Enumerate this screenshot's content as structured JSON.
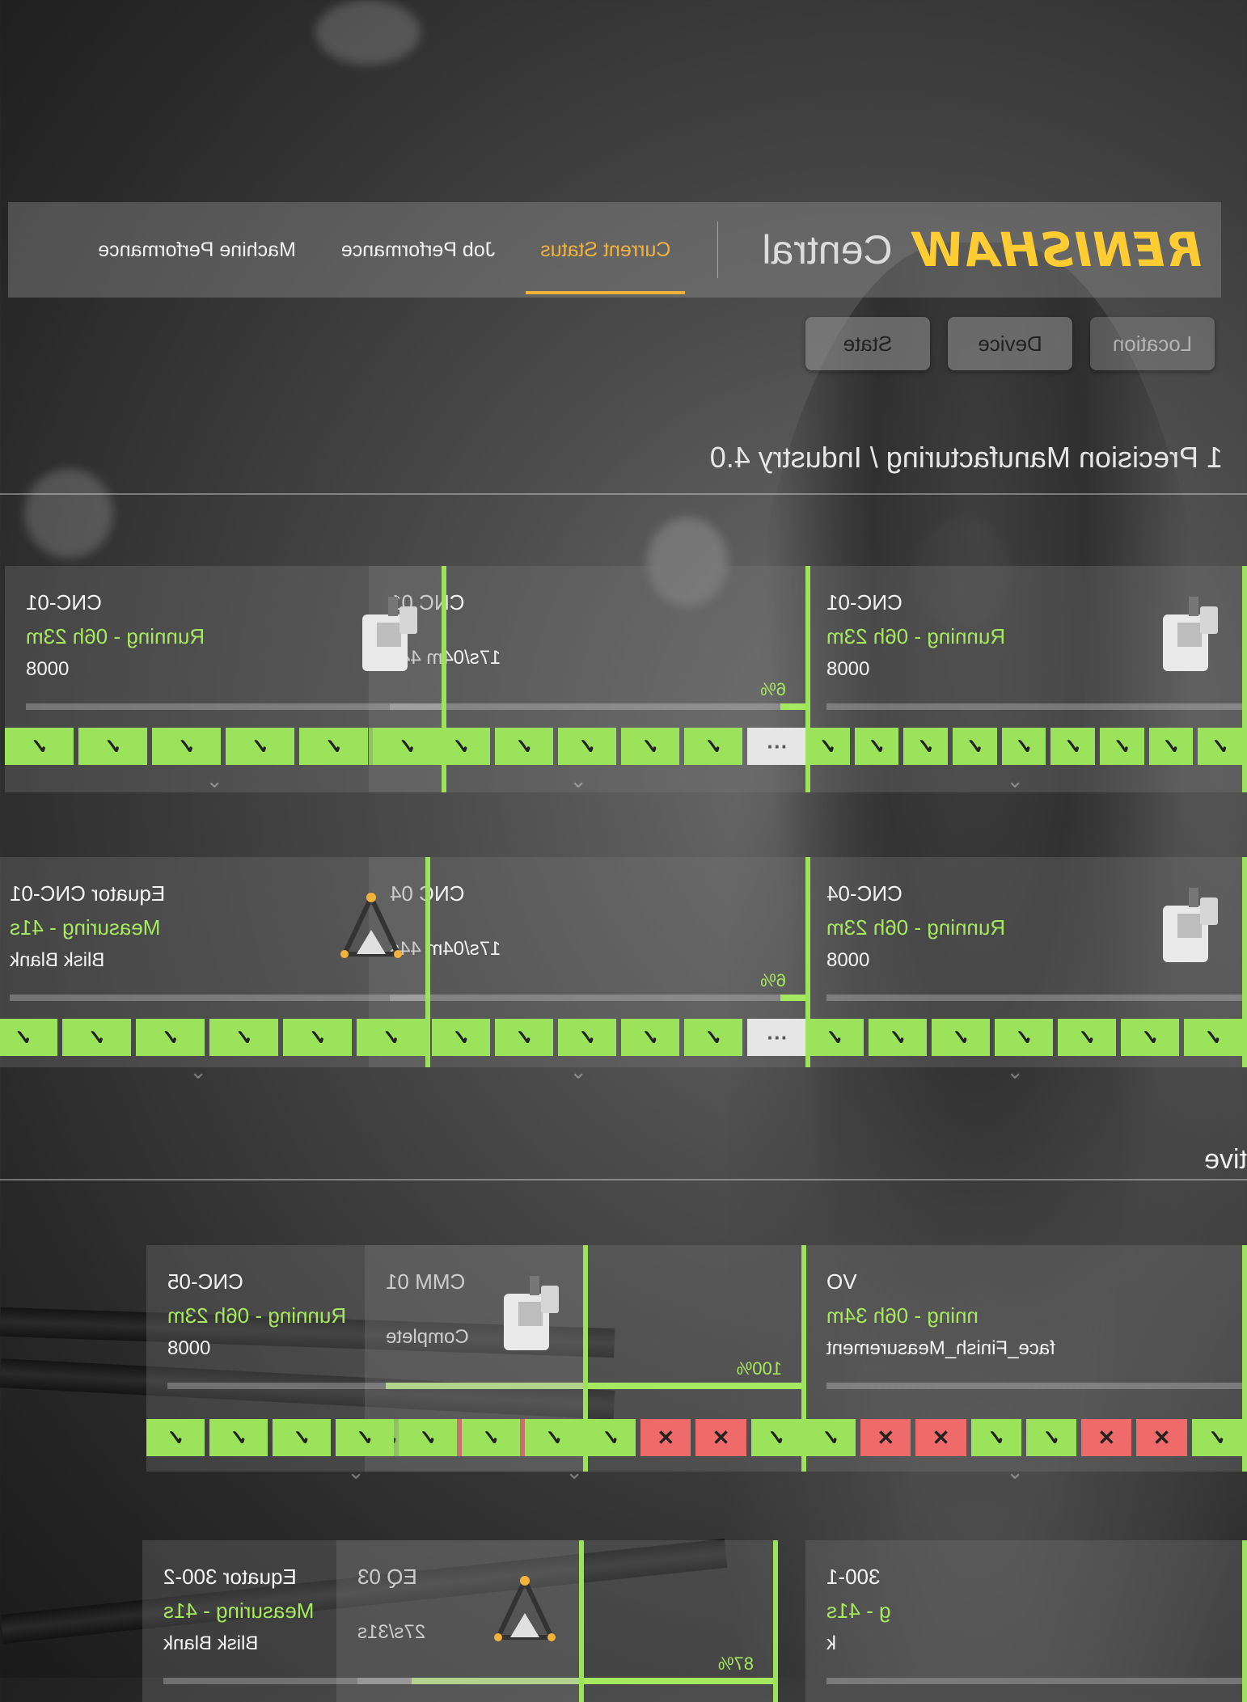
{
  "brand": {
    "logo_text": "RENISHAW",
    "app_name": "Central"
  },
  "nav": {
    "tabs": [
      {
        "label": "Current Status",
        "active": true
      },
      {
        "label": "Job Performance",
        "active": false
      },
      {
        "label": "Machine Performance",
        "active": false
      }
    ]
  },
  "filters": [
    "Location",
    "Device",
    "State"
  ],
  "breadcrumb": "1 Precision Manufacturing / Industry 4.0",
  "sections": {
    "active_label_fragment": "tive"
  },
  "colors": {
    "accent": "#f3b23a",
    "ok": "#9be35a",
    "fail": "#ef6b6b",
    "brand": "#ffcc33"
  },
  "cards": [
    {
      "id": "c1",
      "name": "CNC-01",
      "state": "Running - 06h 23m",
      "detail": "0008",
      "icon": "cnc-machine-icon",
      "steps": [
        "ok",
        "ok",
        "ok",
        "ok",
        "ok",
        "ok",
        "ok",
        "ok",
        "ok"
      ]
    },
    {
      "id": "c2",
      "name": "CNC 01",
      "state": "",
      "detail": "17s/04m 44s",
      "progress": "6%",
      "progress_value": 0.06,
      "icon": "",
      "steps": [
        "more",
        "ok",
        "ok",
        "ok",
        "ok",
        "ok",
        "ok"
      ]
    },
    {
      "id": "c3",
      "name": "CNC-01",
      "state": "Running - 06h 23m",
      "detail": "0008",
      "icon": "cnc-machine-icon",
      "steps": [
        "ok",
        "ok",
        "ok",
        "ok",
        "ok",
        "ok"
      ]
    },
    {
      "id": "c4",
      "name": "CNC-04",
      "state": "Running - 06h 23m",
      "detail": "0008",
      "icon": "cnc-machine-icon",
      "steps": [
        "ok",
        "ok",
        "ok",
        "ok",
        "ok",
        "ok",
        "ok"
      ]
    },
    {
      "id": "c5",
      "name": "CNC 04",
      "state": "",
      "detail": "17s/04m 44s",
      "progress": "6%",
      "progress_value": 0.06,
      "icon": "",
      "steps": [
        "more",
        "ok",
        "ok",
        "ok",
        "ok",
        "ok",
        "ok"
      ]
    },
    {
      "id": "c6",
      "name": "Equator CNC-01",
      "state": "Measuring - 41s",
      "detail": "Blisk Blank",
      "icon": "equator-gauge-icon",
      "steps": [
        "ok",
        "ok",
        "ok",
        "ok",
        "ok",
        "ok"
      ]
    },
    {
      "id": "c7",
      "name": "VO",
      "state": "nning - 06h 34m",
      "detail": "face_Finish_Measurement",
      "icon": "",
      "steps": [
        "ok",
        "fail",
        "fail",
        "ok",
        "ok",
        "fail",
        "fail",
        "ok"
      ]
    },
    {
      "id": "c8",
      "name": "CMM 01",
      "state": "",
      "detail": "Complete",
      "progress": "100%",
      "progress_value": 1.0,
      "icon": "",
      "steps": [
        "ok",
        "fail",
        "fail",
        "ok",
        "ok",
        "fail",
        "fail",
        "ok"
      ]
    },
    {
      "id": "c9",
      "name": "CNC-05",
      "state": "Running - 06h 23m",
      "detail": "0008",
      "icon": "cnc-machine-icon",
      "steps": [
        "ok",
        "ok",
        "ok",
        "ok",
        "ok",
        "ok",
        "ok"
      ]
    },
    {
      "id": "c10",
      "name": "300-1",
      "state": "g - 41s",
      "detail": "k",
      "icon": "",
      "steps": []
    },
    {
      "id": "c11",
      "name": "EQ 03",
      "state": "",
      "detail": "27s/31s",
      "progress": "87%",
      "progress_value": 0.87,
      "icon": "",
      "steps": []
    },
    {
      "id": "c12",
      "name": "Equator 300-2",
      "state": "Measuring - 41s",
      "detail": "Blisk Blank",
      "icon": "equator-gauge-icon",
      "steps": []
    }
  ],
  "step_glyphs": {
    "ok": "✓",
    "fail": "✕",
    "more": "···"
  }
}
